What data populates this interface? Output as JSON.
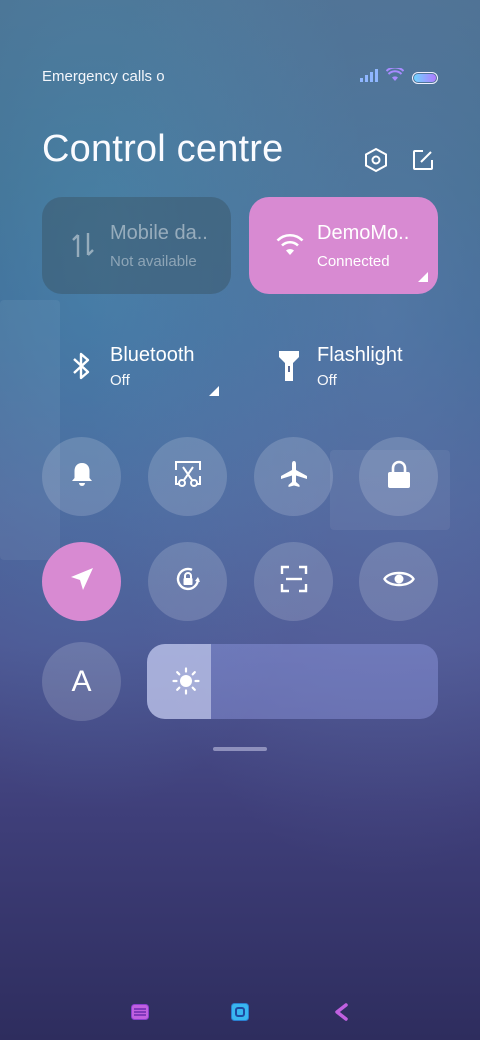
{
  "status": {
    "carrier_text": "Emergency calls o",
    "icons": [
      "signal-icon",
      "wifi-icon",
      "battery-icon"
    ]
  },
  "header": {
    "title": "Control centre",
    "icons": [
      "settings-hexagon-icon",
      "edit-icon"
    ]
  },
  "tiles": {
    "mobile_data": {
      "label": "Mobile da..",
      "status": "Not available",
      "icon": "mobile-data-arrows-icon"
    },
    "wifi": {
      "label": "DemoMo..",
      "status": "Connected",
      "icon": "wifi-icon"
    },
    "bluetooth": {
      "label": "Bluetooth",
      "status": "Off",
      "icon": "bluetooth-icon"
    },
    "flashlight": {
      "label": "Flashlight",
      "status": "Off",
      "icon": "flashlight-icon"
    }
  },
  "toggles": {
    "row1": [
      "bell-icon",
      "screenshot-scissors-icon",
      "airplane-icon",
      "lock-icon"
    ],
    "row2": [
      "location-arrow-icon",
      "rotation-lock-icon",
      "scan-frame-icon",
      "eye-icon"
    ],
    "auto_brightness_label": "A"
  },
  "brightness": {
    "level": 0.22,
    "icon": "sun-icon"
  },
  "colors": {
    "accent": "#d88ad2",
    "tile_dim": "#3c5a6e"
  },
  "nav": [
    "menu-icon",
    "home-square-icon",
    "back-chevron-icon"
  ]
}
